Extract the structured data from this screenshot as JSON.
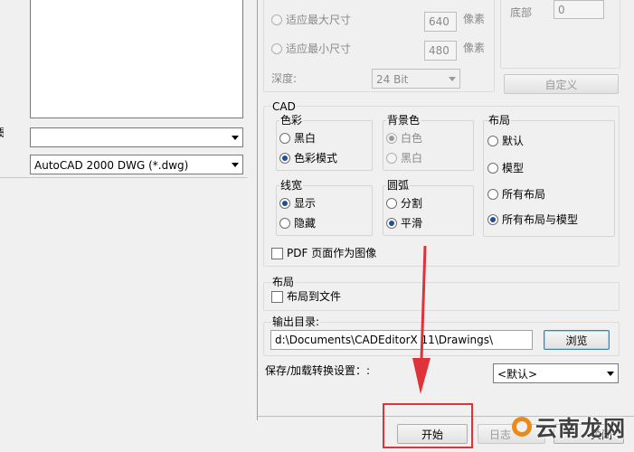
{
  "image_size": {
    "max_size_label": "适应最大尺寸",
    "max_size_value": "640",
    "min_size_label": "适应最小尺寸",
    "min_size_value": "480",
    "pixel_unit": "像素",
    "depth_label": "深度:",
    "depth_value": "24 Bit"
  },
  "margins": {
    "bottom_label": "底部",
    "bottom_value": "0",
    "custom_button": "自定义"
  },
  "left": {
    "format_select": "AutoCAD 2000 DWG (*.dwg)",
    "edge_label": "是"
  },
  "cad": {
    "title": "CAD",
    "color": {
      "title": "色彩",
      "options": [
        "黑白",
        "色彩模式"
      ],
      "selected": 1
    },
    "background": {
      "title": "背景色",
      "options": [
        "白色",
        "黑白"
      ],
      "selected": 0
    },
    "layout": {
      "title": "布局",
      "options": [
        "默认",
        "模型",
        "所有布局",
        "所有布局与模型"
      ],
      "selected": 3
    },
    "lineweight": {
      "title": "线宽",
      "options": [
        "显示",
        "隐藏"
      ],
      "selected": 0
    },
    "arc": {
      "title": "圆弧",
      "options": [
        "分割",
        "平滑"
      ],
      "selected": 1
    },
    "pdf_as_image": "PDF 页面作为图像"
  },
  "layout_section": {
    "title": "布局",
    "layout_to_file": "布局到文件"
  },
  "output": {
    "label": "输出目录:",
    "path": "d:\\Documents\\CADEditorX 11\\Drawings\\",
    "browse_button": "浏览"
  },
  "settings": {
    "label": "保存/加载转换设置：:",
    "selected": "<默认>"
  },
  "footer": {
    "start_button": "开始",
    "log_button": "日志",
    "close_button": "关闭"
  },
  "watermark": "云南龙网",
  "accent_colors": {
    "highlight_box": "#e0323a",
    "arrow": "#e0323a",
    "radio_dot": "#1e4f9c"
  }
}
